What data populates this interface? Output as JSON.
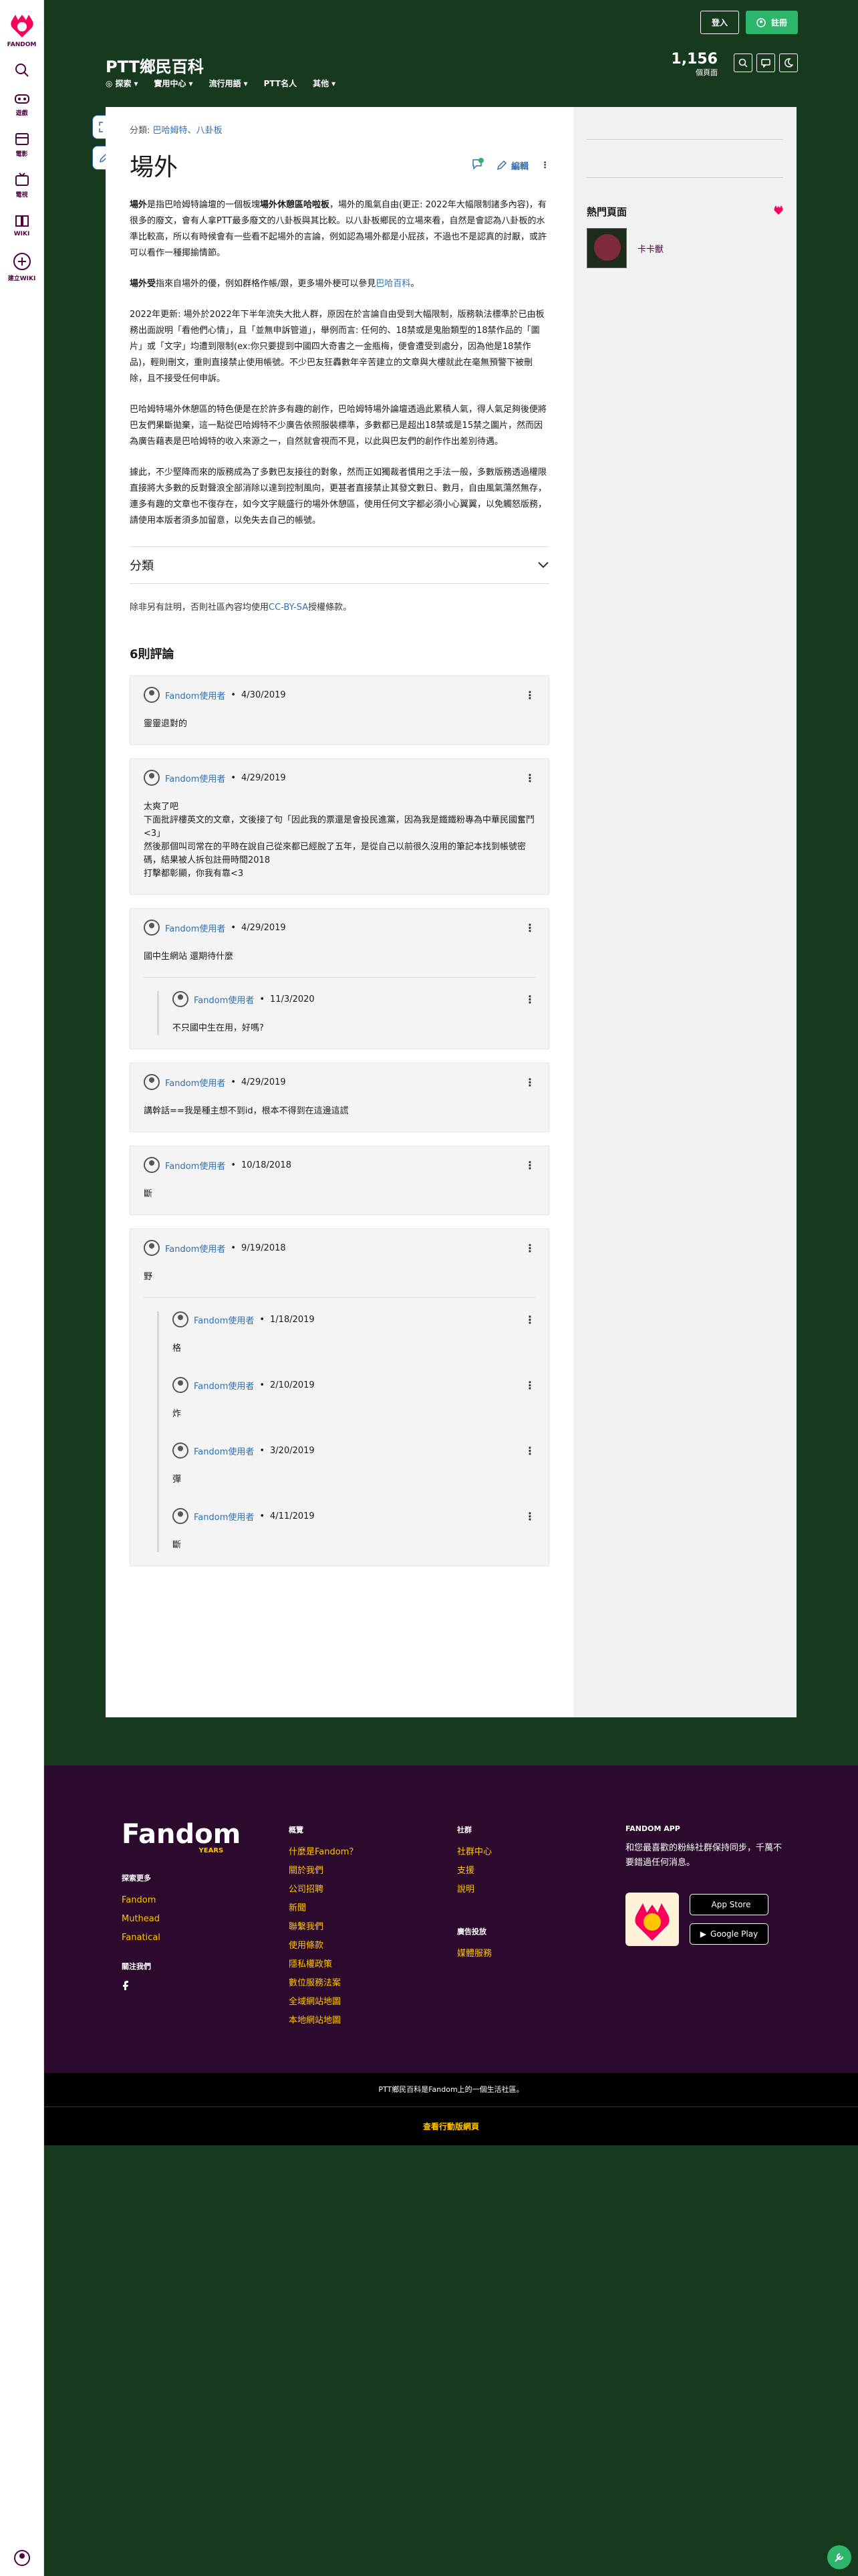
{
  "rail": {
    "fandom": "FANDOM",
    "games": "遊戲",
    "movies": "電影",
    "tv": "電視",
    "wiki": "WIKI",
    "create": "建立WIKI"
  },
  "header": {
    "title": "PTT鄉民百科",
    "nav": [
      "探索",
      "實用中心",
      "流行用語",
      "PTT名人",
      "其他"
    ],
    "login": "登入",
    "register": "註冊",
    "pages_count": "1,156",
    "pages_label": "個頁面"
  },
  "article": {
    "breadcrumb_prefix": "分類:",
    "breadcrumb_links": [
      "巴哈姆特",
      "八卦板"
    ],
    "title": "場外",
    "edit": "編輯",
    "para1_b1": "場外",
    "para1_t1": "是指巴哈姆特論壇的一個板塊",
    "para1_b2": "場外休憩區哈啦板",
    "para1_t2": "，場外的風氣自由(更正: 2022年大幅限制諸多內容)，有很多的廢文，會有人拿PTT最多廢文的八卦板與其比較。以八卦板鄉民的立場來看，自然是會認為八卦板的水準比較高，所以有時候會有一些看不起場外的言論，例如認為場外都是小屁孩，不過也不是認真的討厭，或許可以看作一種揶揄情節。",
    "para2_b": "場外受",
    "para2_t": "指來自場外的優，例如群格作帳/跟，更多場外梗可以參見",
    "para2_link": "巴哈百科",
    "para2_end": "。",
    "para3": "2022年更新: 場外於2022年下半年流失大批人群，原因在於言論自由受到大幅限制，版務執法標準於已由板務出面說明「看他們心情」，且「並無申訴管道」，舉例而言: 任何的、18禁或是鬼胎類型的18禁作品的「圖片」或「文字」均遭到限制(ex:你只要提到中國四大奇書之一金瓶梅，便會遭受到處分，因為他是18禁作品)，輕則刪文，重則直接禁止使用帳號。不少巴友狂轟數年辛苦建立的文章與大樓就此在毫無預警下被刪除，且不接受任何申訴。",
    "para4": "巴哈姆特場外休憩區的特色便是在於許多有趣的創作，巴哈姆特場外論壇透過此累積人氣，得人氣足夠後便將巴友們果斷拋棄，這一點從巴哈姆特不少廣告依照服裝標準，多數都已是超出18禁或是15禁之圖片，然而因為廣告藉表是巴哈姆特的收入來源之一，自然就會視而不見，以此與巴友們的創作作出差別待遇。",
    "para5": "據此，不少堅降而來的版務成為了多數巴友接往的對象，然而正如獨裁者慣用之手法一般，多數版務透過權限直接將大多數的反對聲浪全部消除以達到控制風向，更甚者直接禁止其發文數日、數月，自由風氣蕩然無存，連多有趣的文章也不復存在，如今文字競盛行的場外休憩區，使用任何文字都必須小心翼翼，以免觸怒版務，請使用本版者須多加留意，以免失去自己的帳號。",
    "categories": "分類",
    "license_pre": "除非另有註明，否則社區內容均使用",
    "license_link": "CC-BY-SA",
    "license_post": "授權條款。",
    "comment_count": "6則評論"
  },
  "comments": [
    {
      "author": "Fandom使用者",
      "date": "4/30/2019",
      "text": "靈靈退對的",
      "replies": []
    },
    {
      "author": "Fandom使用者",
      "date": "4/29/2019",
      "text": "太爽了吧\n下面批評樓英文的文章，文後接了句「因此我的票還是會投民進黨，因為我是鐵鐵粉專為中華民國奮鬥<3」\n然後那個叫司常在的平時在說自己從來都已經脫了五年，是從自己以前很久沒用的筆記本找到帳號密碼，結果被人拆包註冊時間2018\n打擊都彰顯，你我有靠<3",
      "replies": []
    },
    {
      "author": "Fandom使用者",
      "date": "4/29/2019",
      "text": "國中生網站 還期待什麼",
      "replies": [
        {
          "author": "Fandom使用者",
          "date": "11/3/2020",
          "text": "不只國中生在用，好嗎?"
        }
      ]
    },
    {
      "author": "Fandom使用者",
      "date": "4/29/2019",
      "text": "講幹話==我是種主想不到id，根本不得到在這邊這謊",
      "replies": []
    },
    {
      "author": "Fandom使用者",
      "date": "10/18/2018",
      "text": "斷",
      "replies": []
    },
    {
      "author": "Fandom使用者",
      "date": "9/19/2018",
      "text": "野",
      "replies": [
        {
          "author": "Fandom使用者",
          "date": "1/18/2019",
          "text": "格"
        },
        {
          "author": "Fandom使用者",
          "date": "2/10/2019",
          "text": "炸"
        },
        {
          "author": "Fandom使用者",
          "date": "3/20/2019",
          "text": "彈"
        },
        {
          "author": "Fandom使用者",
          "date": "4/11/2019",
          "text": "斷"
        }
      ]
    }
  ],
  "sidebar": {
    "popular_title": "熱門頁面",
    "popular_items": [
      "卡卡獸"
    ]
  },
  "footer": {
    "logo": "Fandom",
    "anniv": "YEARS",
    "explore_title": "探索更多",
    "explore": [
      "Fandom",
      "Muthead",
      "Fanatical"
    ],
    "follow_title": "關注我們",
    "overview_title": "概覽",
    "overview": [
      "什麼是Fandom？",
      "關於我們",
      "公司招聘",
      "新聞",
      "聯繫我們",
      "使用條款",
      "隱私權政策",
      "數位服務法案",
      "全域網站地圖",
      "本地網站地圖"
    ],
    "community_title": "社群",
    "community": [
      "社群中心",
      "支援",
      "說明"
    ],
    "ads_title": "廣告投放",
    "ads": [
      "媒體服務"
    ],
    "app_title": "FANDOM APP",
    "app_desc": "和您最喜歡的粉絲社群保持同步，千萬不要錯過任何消息。",
    "app_store": "App Store",
    "google_play": "Google Play",
    "bottom_note": "PTT鄉民百科是Fandom上的一個生活社區。",
    "mobile_link": "查看行動版網頁"
  }
}
